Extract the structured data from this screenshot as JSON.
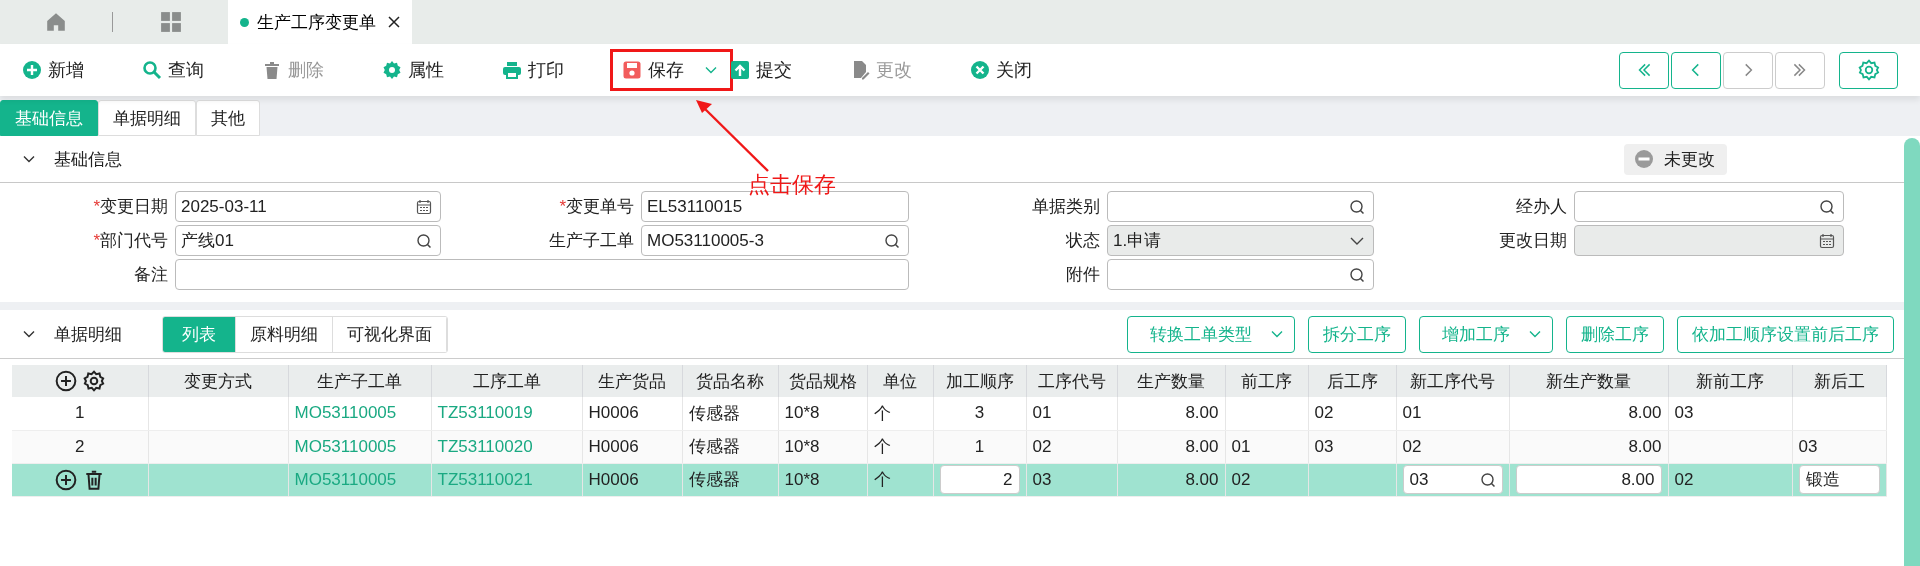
{
  "top_tabs": [
    {
      "kind": "home",
      "selected": false
    },
    {
      "kind": "apps",
      "selected": false
    },
    {
      "kind": "document",
      "label": "生产工序变更单",
      "selected": true
    }
  ],
  "toolbar": {
    "buttons": [
      {
        "kind": "add",
        "label": "新增",
        "disabled": false,
        "highlighted": false,
        "dropdown": false
      },
      {
        "kind": "query",
        "label": "查询",
        "disabled": false,
        "highlighted": false,
        "dropdown": false
      },
      {
        "kind": "delete",
        "label": "删除",
        "disabled": true,
        "highlighted": false,
        "dropdown": false
      },
      {
        "kind": "properties",
        "label": "属性",
        "disabled": false,
        "highlighted": false,
        "dropdown": false
      },
      {
        "kind": "print",
        "label": "打印",
        "disabled": false,
        "highlighted": false,
        "dropdown": false
      },
      {
        "kind": "save",
        "label": "保存",
        "disabled": false,
        "highlighted": true,
        "dropdown": true
      },
      {
        "kind": "submit",
        "label": "提交",
        "disabled": false,
        "highlighted": false,
        "dropdown": false
      },
      {
        "kind": "modify",
        "label": "更改",
        "disabled": true,
        "highlighted": false,
        "dropdown": false
      },
      {
        "kind": "close",
        "label": "关闭",
        "disabled": false,
        "highlighted": false,
        "dropdown": false
      }
    ],
    "pager": [
      {
        "kind": "first",
        "disabled": false
      },
      {
        "kind": "prev",
        "disabled": false
      },
      {
        "kind": "next",
        "disabled": true
      },
      {
        "kind": "last",
        "disabled": true
      }
    ]
  },
  "annotation": {
    "text": "点击保存"
  },
  "sub_tabs": [
    {
      "label": "基础信息",
      "selected": true
    },
    {
      "label": "单据明细",
      "selected": false
    },
    {
      "label": "其他",
      "selected": false
    }
  ],
  "basic_info": {
    "title": "基础信息",
    "expanded": true,
    "status": "未更改",
    "rows": [
      [
        {
          "mark": "*",
          "label": "变更日期",
          "value": "2025-03-11",
          "kind": "date",
          "disabled": false
        },
        {
          "mark": "*",
          "label": "变更单号",
          "value": "EL53110015",
          "kind": "text",
          "disabled": false
        },
        {
          "label": "单据类别",
          "kind": "lookup",
          "disabled": false
        },
        {
          "label": "经办人",
          "kind": "lookup",
          "disabled": false
        }
      ],
      [
        {
          "mark": "*",
          "label": "部门代号",
          "value": "产线01",
          "kind": "lookup",
          "disabled": false
        },
        {
          "label": "生产子工单",
          "value": "MO53110005-3",
          "kind": "lookup",
          "disabled": false
        },
        {
          "label": "状态",
          "value": "1.申请",
          "kind": "select",
          "disabled": true
        },
        {
          "label": "更改日期",
          "kind": "date",
          "disabled": true
        }
      ],
      [
        {
          "label": "备注",
          "kind": "text",
          "disabled": false
        },
        "",
        {
          "label": "附件",
          "kind": "lookup",
          "disabled": false
        }
      ]
    ]
  },
  "details": {
    "title": "单据明细",
    "expanded": true,
    "views": [
      {
        "label": "列表",
        "selected": true
      },
      {
        "label": "原料明细",
        "selected": false
      },
      {
        "label": "可视化界面",
        "selected": false
      }
    ],
    "actions": [
      {
        "label": "转换工单类型",
        "dropdown": true
      },
      {
        "label": "拆分工序",
        "dropdown": false
      },
      {
        "label": "增加工序",
        "dropdown": true
      },
      {
        "label": "删除工序",
        "dropdown": false
      },
      {
        "label": "依加工顺序设置前后工序",
        "dropdown": false
      }
    ],
    "table": {
      "columns": [
        {
          "kind": "tools"
        },
        {
          "kind": "text",
          "label": "变更方式"
        },
        {
          "kind": "text",
          "label": "生产子工单"
        },
        {
          "kind": "text",
          "label": "工序工单"
        },
        {
          "kind": "text",
          "label": "生产货品"
        },
        {
          "kind": "text",
          "label": "货品名称"
        },
        {
          "kind": "text",
          "label": "货品规格"
        },
        {
          "kind": "text",
          "label": "单位"
        },
        {
          "kind": "text",
          "label": "加工顺序"
        },
        {
          "kind": "text",
          "label": "工序代号"
        },
        {
          "kind": "text",
          "label": "生产数量"
        },
        {
          "kind": "text",
          "label": "前工序"
        },
        {
          "kind": "text",
          "label": "后工序"
        },
        {
          "kind": "text",
          "label": "新工序代号"
        },
        {
          "kind": "text",
          "label": "新生产数量"
        },
        {
          "kind": "text",
          "label": "新前工序"
        },
        {
          "kind": "text",
          "label": "新后工"
        }
      ],
      "rows": [
        {
          "selected": false,
          "cells": [
            {
              "kind": "text",
              "text": "1"
            },
            {
              "kind": "empty"
            },
            {
              "kind": "link",
              "text": "MO53110005"
            },
            {
              "kind": "link",
              "text": "TZ53110019"
            },
            {
              "kind": "text",
              "text": "H0006"
            },
            {
              "kind": "text",
              "text": "传感器"
            },
            {
              "kind": "text",
              "text": "10*8"
            },
            {
              "kind": "text",
              "text": "个"
            },
            {
              "kind": "text",
              "text": "3"
            },
            {
              "kind": "text",
              "text": "01"
            },
            {
              "kind": "text",
              "text": "8.00"
            },
            {
              "kind": "empty"
            },
            {
              "kind": "text",
              "text": "02"
            },
            {
              "kind": "text",
              "text": "01"
            },
            {
              "kind": "text",
              "text": "8.00"
            },
            {
              "kind": "text",
              "text": "03"
            },
            {
              "kind": "empty"
            }
          ]
        },
        {
          "selected": false,
          "cells": [
            {
              "kind": "text",
              "text": "2"
            },
            {
              "kind": "empty"
            },
            {
              "kind": "link",
              "text": "MO53110005"
            },
            {
              "kind": "link",
              "text": "TZ53110020"
            },
            {
              "kind": "text",
              "text": "H0006"
            },
            {
              "kind": "text",
              "text": "传感器"
            },
            {
              "kind": "text",
              "text": "10*8"
            },
            {
              "kind": "text",
              "text": "个"
            },
            {
              "kind": "text",
              "text": "1"
            },
            {
              "kind": "text",
              "text": "02"
            },
            {
              "kind": "text",
              "text": "8.00"
            },
            {
              "kind": "text",
              "text": "01"
            },
            {
              "kind": "text",
              "text": "03"
            },
            {
              "kind": "text",
              "text": "02"
            },
            {
              "kind": "text",
              "text": "8.00"
            },
            {
              "kind": "empty"
            },
            {
              "kind": "text",
              "text": "03"
            }
          ]
        },
        {
          "selected": true,
          "cells": [
            {
              "kind": "row_tools"
            },
            {
              "kind": "empty"
            },
            {
              "kind": "link",
              "text": "MO53110005"
            },
            {
              "kind": "link",
              "text": "TZ53110021"
            },
            {
              "kind": "text",
              "text": "H0006"
            },
            {
              "kind": "text",
              "text": "传感器"
            },
            {
              "kind": "text",
              "text": "10*8"
            },
            {
              "kind": "text",
              "text": "个"
            },
            {
              "kind": "input",
              "text": "2"
            },
            {
              "kind": "text",
              "text": "03"
            },
            {
              "kind": "text",
              "text": "8.00"
            },
            {
              "kind": "text",
              "text": "02"
            },
            {
              "kind": "empty"
            },
            {
              "kind": "lookup",
              "text": "03"
            },
            {
              "kind": "input",
              "text": "8.00"
            },
            {
              "kind": "text",
              "text": "02"
            },
            {
              "kind": "input",
              "text": "锻造"
            }
          ]
        }
      ]
    }
  }
}
